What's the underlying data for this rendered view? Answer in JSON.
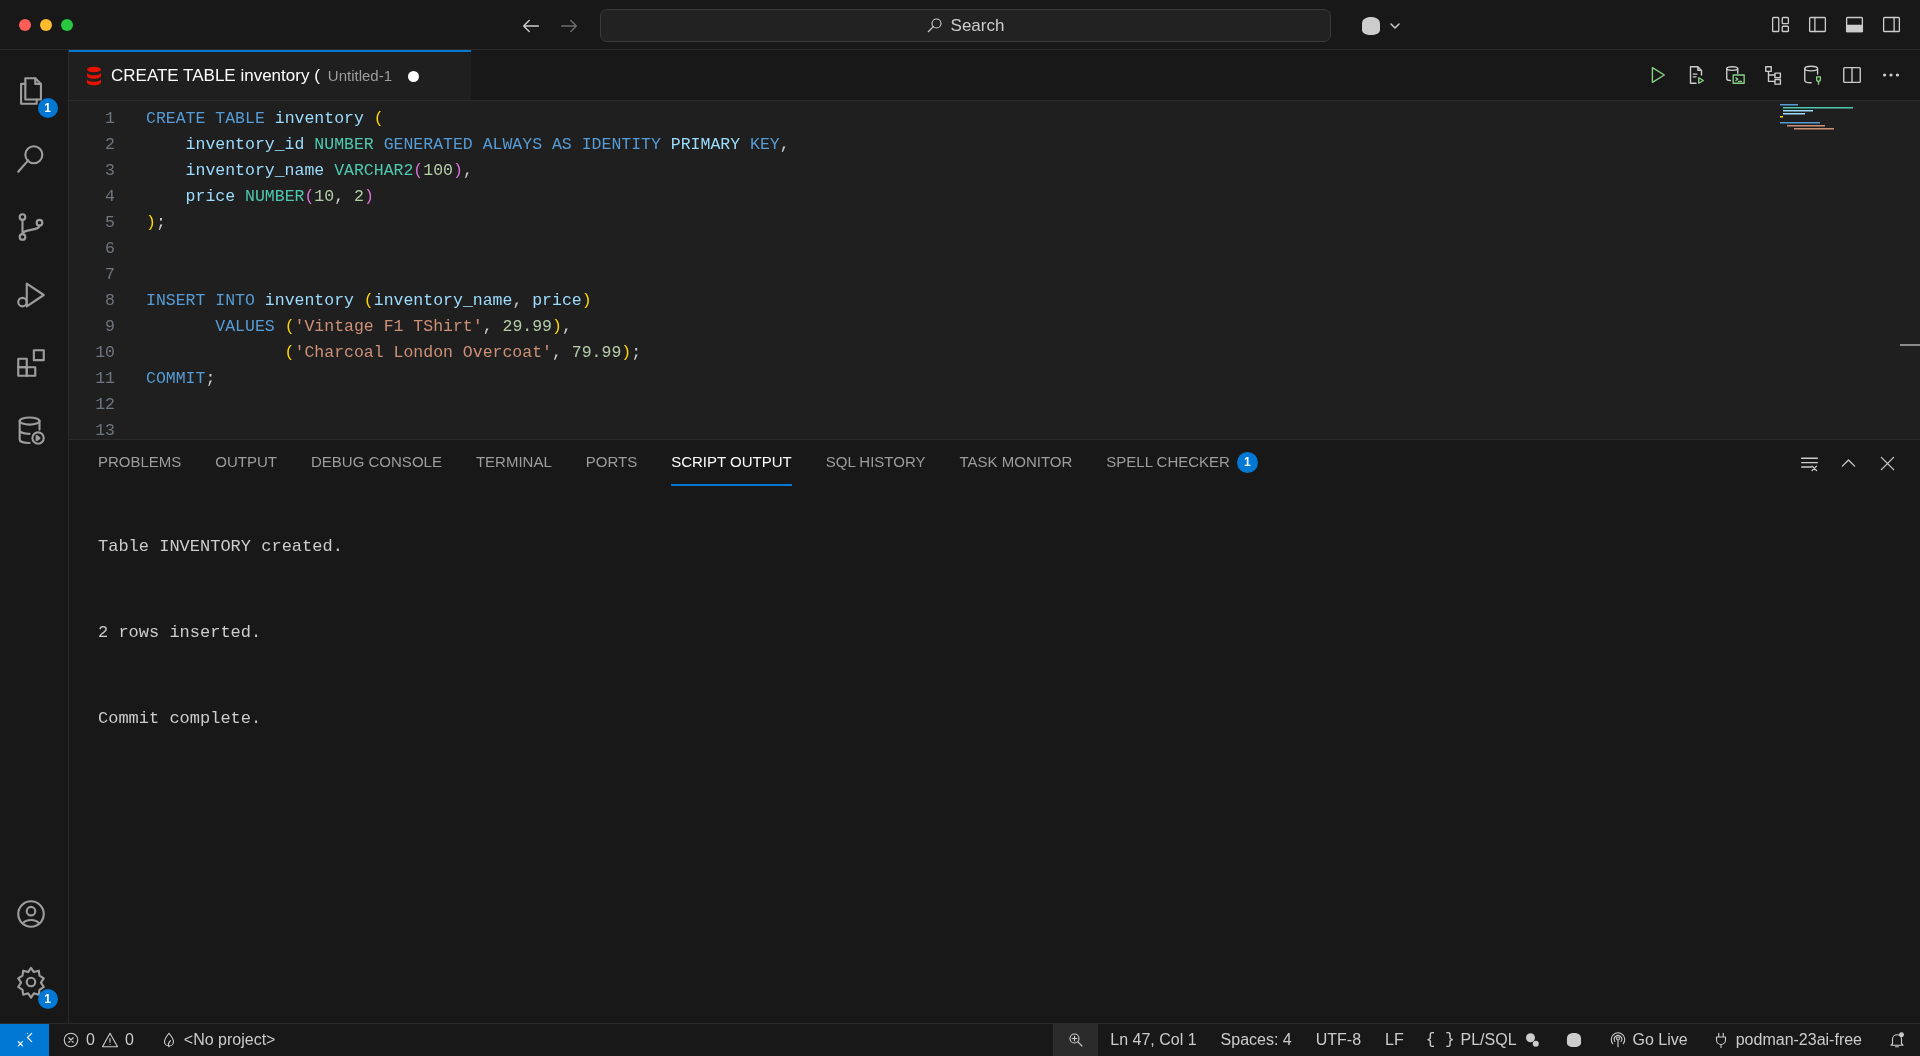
{
  "title_bar": {
    "search": {
      "placeholder": "Search"
    }
  },
  "activity_bar": {
    "files_badge": "1",
    "settings_badge": "1"
  },
  "editor_tab": {
    "title": "CREATE TABLE inventory (",
    "description": "Untitled-1",
    "modified": true,
    "selected": true
  },
  "code": [
    {
      "number": "1",
      "tokens": [
        {
          "kind": "kw",
          "text": "CREATE TABLE "
        },
        {
          "kind": "id",
          "text": "inventory "
        },
        {
          "kind": "p1",
          "text": "("
        }
      ]
    },
    {
      "number": "2",
      "tokens": [
        {
          "kind": "id",
          "text": "    inventory_id "
        },
        {
          "kind": "ty",
          "text": "NUMBER "
        },
        {
          "kind": "kw",
          "text": "GENERATED ALWAYS AS IDENTITY "
        },
        {
          "kind": "id",
          "text": "PRIMARY "
        },
        {
          "kind": "kw",
          "text": "KEY"
        },
        {
          "kind": "pu",
          "text": ","
        }
      ]
    },
    {
      "number": "3",
      "tokens": [
        {
          "kind": "id",
          "text": "    inventory_name "
        },
        {
          "kind": "ty",
          "text": "VARCHAR2"
        },
        {
          "kind": "p2",
          "text": "("
        },
        {
          "kind": "nu",
          "text": "100"
        },
        {
          "kind": "p2",
          "text": ")"
        },
        {
          "kind": "pu",
          "text": ","
        }
      ]
    },
    {
      "number": "4",
      "tokens": [
        {
          "kind": "id",
          "text": "    price "
        },
        {
          "kind": "ty",
          "text": "NUMBER"
        },
        {
          "kind": "p2",
          "text": "("
        },
        {
          "kind": "nu",
          "text": "10"
        },
        {
          "kind": "pu",
          "text": ", "
        },
        {
          "kind": "nu",
          "text": "2"
        },
        {
          "kind": "p2",
          "text": ")"
        }
      ]
    },
    {
      "number": "5",
      "tokens": [
        {
          "kind": "p1",
          "text": ")"
        },
        {
          "kind": "pu",
          "text": ";"
        }
      ]
    },
    {
      "number": "6"
    },
    {
      "number": "7"
    },
    {
      "number": "8",
      "tokens": [
        {
          "kind": "kw",
          "text": "INSERT INTO "
        },
        {
          "kind": "id",
          "text": "inventory "
        },
        {
          "kind": "p1",
          "text": "("
        },
        {
          "kind": "id",
          "text": "inventory_name"
        },
        {
          "kind": "pu",
          "text": ", "
        },
        {
          "kind": "id",
          "text": "price"
        },
        {
          "kind": "p1",
          "text": ")"
        }
      ]
    },
    {
      "number": "9",
      "tokens": [
        {
          "kind": "kw",
          "text": "       VALUES "
        },
        {
          "kind": "p1",
          "text": "("
        },
        {
          "kind": "st",
          "text": "'Vintage F1 TShirt'"
        },
        {
          "kind": "pu",
          "text": ", "
        },
        {
          "kind": "nu",
          "text": "29.99"
        },
        {
          "kind": "p1",
          "text": ")"
        },
        {
          "kind": "pu",
          "text": ","
        }
      ]
    },
    {
      "number": "10",
      "tokens": [
        {
          "kind": "p1",
          "text": "              ("
        },
        {
          "kind": "st",
          "text": "'Charcoal London Overcoat'"
        },
        {
          "kind": "pu",
          "text": ", "
        },
        {
          "kind": "nu",
          "text": "79.99"
        },
        {
          "kind": "p1",
          "text": ")"
        },
        {
          "kind": "pu",
          "text": ";"
        }
      ]
    },
    {
      "number": "11",
      "tokens": [
        {
          "kind": "kw",
          "text": "COMMIT"
        },
        {
          "kind": "pu",
          "text": ";"
        }
      ]
    },
    {
      "number": "12"
    },
    {
      "number": "13"
    }
  ],
  "panel": {
    "tabs": [
      {
        "label": "PROBLEMS",
        "selected": false
      },
      {
        "label": "OUTPUT",
        "selected": false
      },
      {
        "label": "DEBUG CONSOLE",
        "selected": false
      },
      {
        "label": "TERMINAL",
        "selected": false
      },
      {
        "label": "PORTS",
        "selected": false
      },
      {
        "label": "SCRIPT OUTPUT",
        "selected": true
      },
      {
        "label": "SQL HISTORY",
        "selected": false
      },
      {
        "label": "TASK MONITOR",
        "selected": false
      },
      {
        "label": "SPELL CHECKER",
        "selected": false,
        "badge": "1"
      }
    ],
    "output": [
      "Table INVENTORY created.",
      "2 rows inserted.",
      "Commit complete."
    ]
  },
  "status_bar": {
    "errors": "0",
    "warnings": "0",
    "project": "<No project>",
    "position": "Ln 47, Col 1",
    "spaces": "Spaces: 4",
    "encoding": "UTF-8",
    "eol": "LF",
    "braces": "{ }",
    "language": "PL/SQL",
    "go_live": "Go Live",
    "connection": "podman-23ai-free"
  }
}
